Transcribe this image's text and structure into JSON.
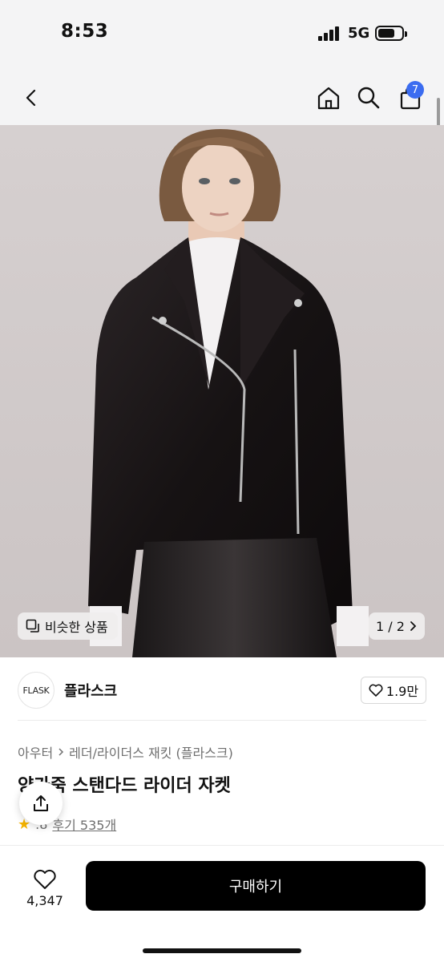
{
  "status_bar": {
    "time": "8:53",
    "network": "5G"
  },
  "header": {
    "cart_count": "7",
    "icons": [
      "back-arrow-icon",
      "home-icon",
      "search-icon",
      "cart-icon"
    ]
  },
  "gallery": {
    "similar_label": "비슷한 상품",
    "page_indicator": "1 / 2",
    "current_page": 1,
    "total_pages": 2
  },
  "brand": {
    "logo_text": "FLASK",
    "name": "플라스크",
    "likes": "1.9만"
  },
  "breadcrumb": {
    "level1": "아우터",
    "level2": "레더/라이더스 재킷 (플라스크)"
  },
  "product": {
    "title": "양가죽 스탠다드 라이더 자켓",
    "rating": ".8",
    "reviews": "후기 535개"
  },
  "bottom_bar": {
    "wish_count": "4,347",
    "buy_label": "구매하기"
  },
  "colors": {
    "accent_badge": "#3b6cf0",
    "buy_button": "#000000",
    "rating_star": "#f5b400"
  }
}
